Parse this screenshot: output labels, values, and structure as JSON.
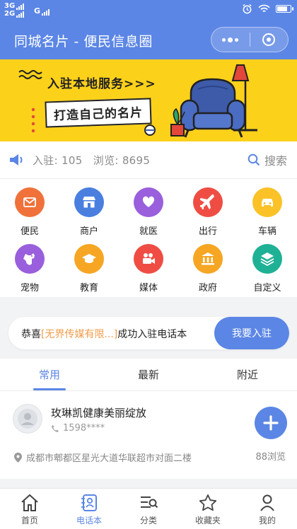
{
  "status": {
    "net1": "3G",
    "net2": "2G",
    "net3": "G",
    "battery_level": 0.8
  },
  "nav": {
    "title": "同城名片 - 便民信息圈"
  },
  "banner": {
    "line1": "入驻本地服务>>>",
    "line2": "打造自己的名片"
  },
  "stats": {
    "joined_label": "入驻:",
    "joined_value": "105",
    "views_label": "浏览:",
    "views_value": "8695",
    "search_label": "搜索"
  },
  "categories": [
    {
      "label": "便民",
      "icon": "mail-icon",
      "color": "#f0723a"
    },
    {
      "label": "商户",
      "icon": "store-icon",
      "color": "#4a7fe0"
    },
    {
      "label": "就医",
      "icon": "heart-icon",
      "color": "#9a5fdc"
    },
    {
      "label": "出行",
      "icon": "plane-icon",
      "color": "#ef4d44"
    },
    {
      "label": "车辆",
      "icon": "car-icon",
      "color": "#fbc227"
    },
    {
      "label": "宠物",
      "icon": "dog-icon",
      "color": "#9a5fdc"
    },
    {
      "label": "教育",
      "icon": "graduation-cap-icon",
      "color": "#f6a623"
    },
    {
      "label": "媒体",
      "icon": "video-camera-icon",
      "color": "#ef4d44"
    },
    {
      "label": "政府",
      "icon": "bank-icon",
      "color": "#f6a623"
    },
    {
      "label": "自定义",
      "icon": "layers-icon",
      "color": "#1fb196"
    }
  ],
  "notice": {
    "prefix": "恭喜",
    "highlight": "[无界传媒有限...]",
    "suffix": "成功入驻电话本",
    "button": "我要入驻"
  },
  "tabs": [
    {
      "label": "常用"
    },
    {
      "label": "最新"
    },
    {
      "label": "附近"
    }
  ],
  "card": {
    "name": "玫琳凯健康美丽绽放",
    "phone": "1598****",
    "address": "成都市郫都区星光大道华联超市对面二楼",
    "views": "88浏览"
  },
  "tabbar": [
    {
      "label": "首页",
      "icon": "home-icon"
    },
    {
      "label": "电话本",
      "icon": "contacts-icon"
    },
    {
      "label": "分类",
      "icon": "category-icon"
    },
    {
      "label": "收藏夹",
      "icon": "star-icon"
    },
    {
      "label": "我的",
      "icon": "user-icon"
    }
  ],
  "colors": {
    "primary": "#5b86e5",
    "banner": "#fcd11a",
    "highlight": "#f39c4a"
  }
}
